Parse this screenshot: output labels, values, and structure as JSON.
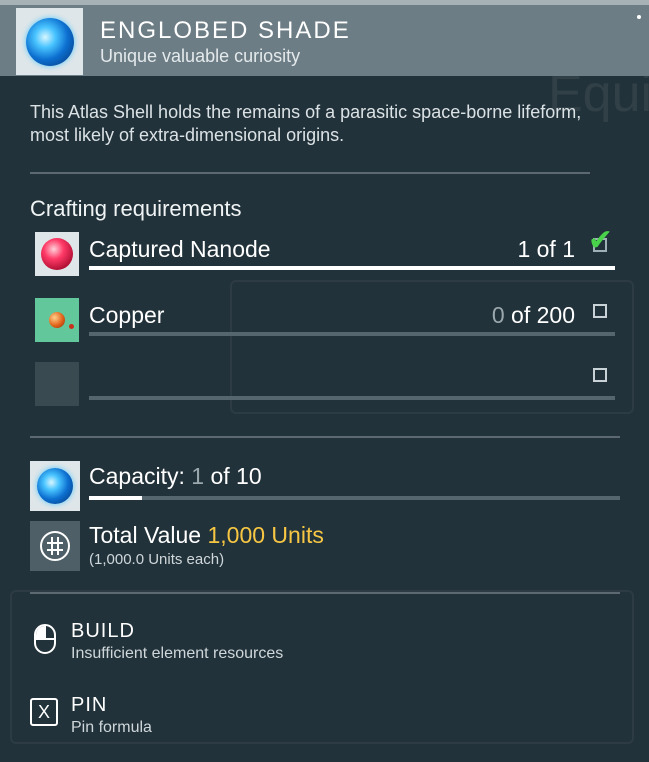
{
  "item": {
    "title": "ENGLOBED SHADE",
    "subtitle": "Unique valuable curiosity",
    "icon": "blue-orb-icon",
    "description": "This Atlas Shell holds the remains of a parasitic space-borne lifeform, most likely of extra-dimensional origins."
  },
  "crafting": {
    "title": "Crafting requirements",
    "requirements": [
      {
        "name": "Captured Nanode",
        "have": "1",
        "of_text": " of 1",
        "fraction": 1.0,
        "complete": true,
        "icon": "nanode-icon"
      },
      {
        "name": "Copper",
        "have": "0",
        "of_text": " of 200",
        "fraction": 0.0,
        "complete": false,
        "icon": "copper-icon"
      },
      {
        "name": "",
        "have": "",
        "of_text": "",
        "fraction": 0.0,
        "complete": false,
        "icon": "empty-slot"
      }
    ]
  },
  "capacity": {
    "label": "Capacity: ",
    "current": "1",
    "of_text": " of 10",
    "fraction": 0.1
  },
  "value": {
    "label": "Total Value ",
    "amount": "1,000 Units",
    "each": "(1,000.0 Units each)",
    "icon": "units-icon"
  },
  "actions": {
    "build": {
      "title": "BUILD",
      "subtitle": "Insufficient element resources",
      "icon": "mouse-left-click-icon"
    },
    "pin": {
      "title": "PIN",
      "subtitle": "Pin formula",
      "key": "X"
    }
  },
  "colors": {
    "accent_value": "#f7c744",
    "check_green": "#49d34a",
    "header_bg": "#6d7d85",
    "panel_bg": "#22323a"
  }
}
